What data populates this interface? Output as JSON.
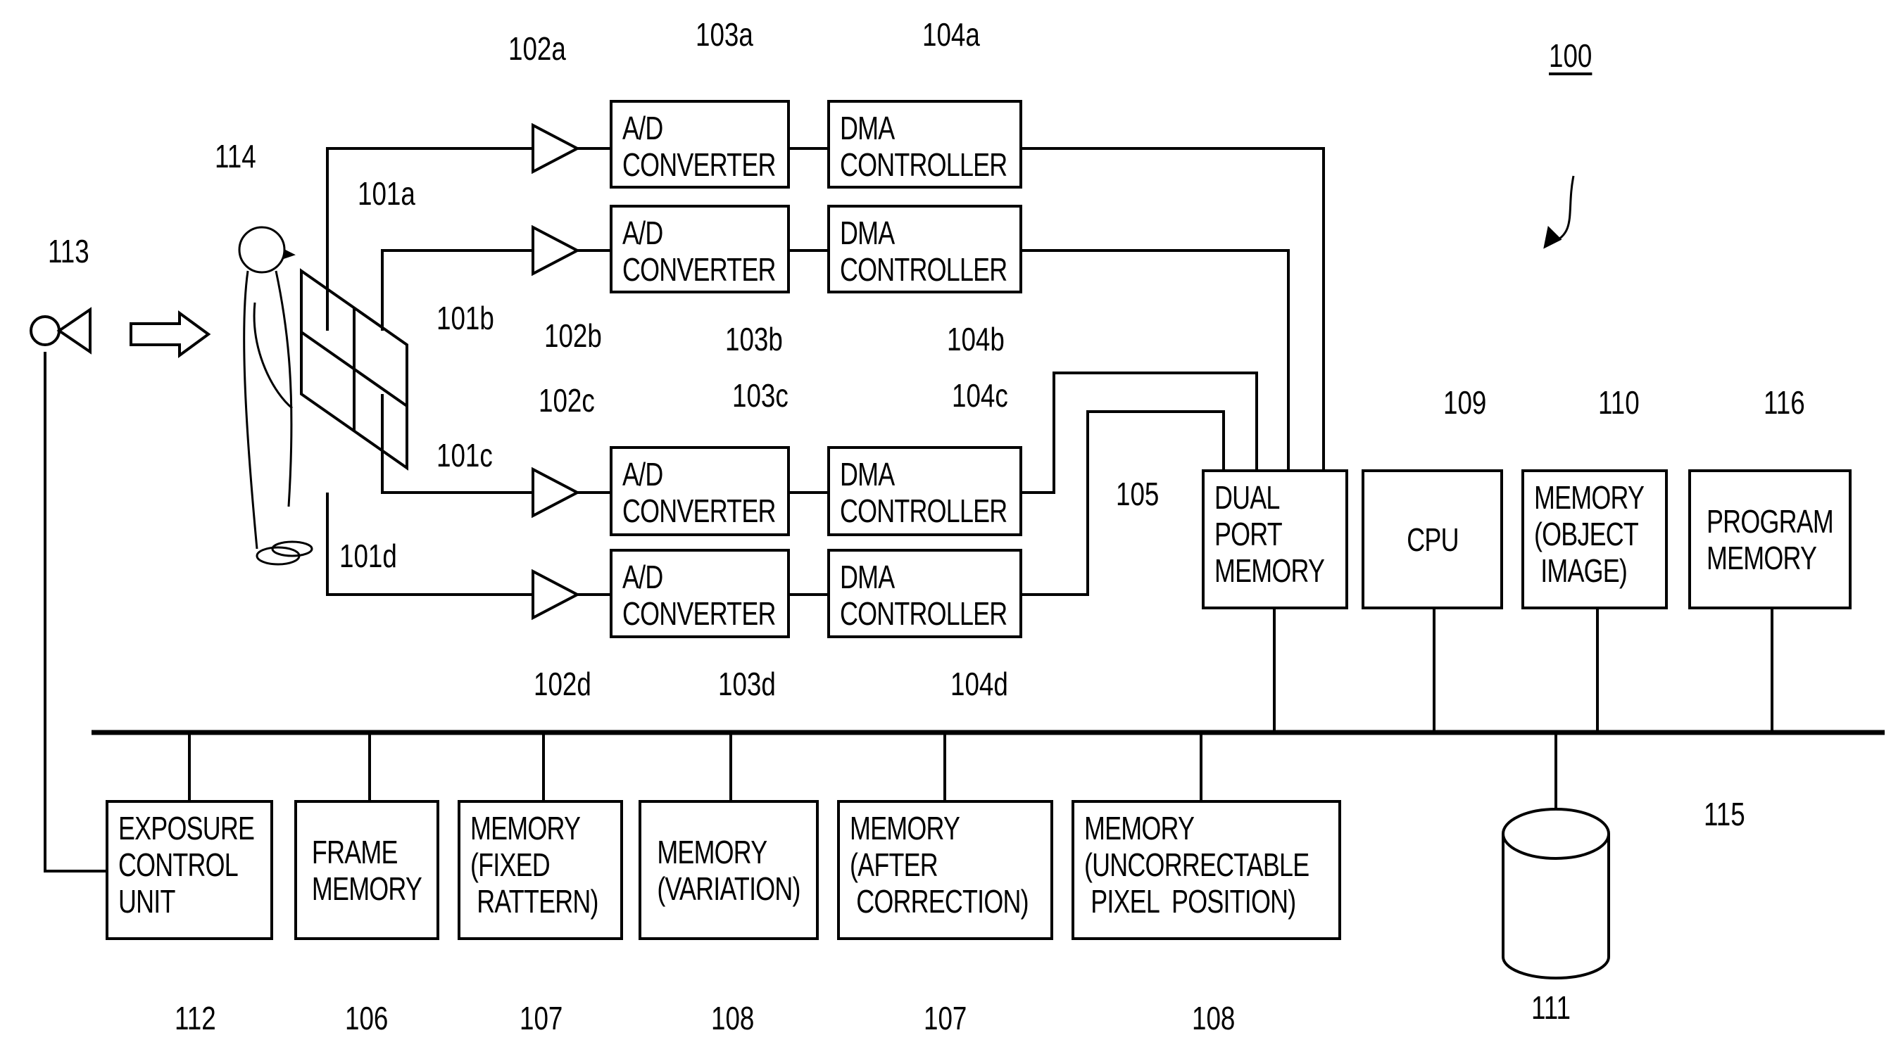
{
  "figure": {
    "system_ref": "100",
    "person_ref": "114",
    "light_source_ref": "113",
    "bus_ref": "115",
    "disk_ref": "111",
    "sensor_refs": [
      "101a",
      "101b",
      "101c",
      "101d"
    ]
  },
  "channels": [
    {
      "amp_ref": "102a",
      "adc_ref": "103a",
      "dma_ref": "104a",
      "adc_label": "A/D\nCONVERTER",
      "dma_label": "DMA\nCONTROLLER"
    },
    {
      "amp_ref": "102b",
      "adc_ref": "103b",
      "dma_ref": "104b",
      "adc_label": "A/D\nCONVERTER",
      "dma_label": "DMA\nCONTROLLER"
    },
    {
      "amp_ref": "102c",
      "adc_ref": "103c",
      "dma_ref": "104c",
      "adc_label": "A/D\nCONVERTER",
      "dma_label": "DMA\nCONTROLLER"
    },
    {
      "amp_ref": "102d",
      "adc_ref": "103d",
      "dma_ref": "104d",
      "adc_label": "A/D\nCONVERTER",
      "dma_label": "DMA\nCONTROLLER"
    }
  ],
  "upper_blocks": [
    {
      "ref": "105",
      "label": "DUAL\nPORT\nMEMORY"
    },
    {
      "ref": "109",
      "label": "CPU"
    },
    {
      "ref": "110",
      "label": "MEMORY\n(OBJECT\n IMAGE)"
    },
    {
      "ref": "116",
      "label": "PROGRAM\nMEMORY"
    }
  ],
  "lower_blocks": [
    {
      "ref": "112",
      "label": "EXPOSURE\nCONTROL\nUNIT"
    },
    {
      "ref": "106",
      "label": "FRAME\nMEMORY"
    },
    {
      "ref": "107",
      "label": "MEMORY\n(FIXED\n RATTERN)"
    },
    {
      "ref": "108",
      "label": "MEMORY\n(VARIATION)"
    },
    {
      "ref": "107",
      "label": "MEMORY\n(AFTER\n CORRECTION)"
    },
    {
      "ref": "108",
      "label": "MEMORY\n(UNCORRECTABLE\n PIXEL  POSITION)"
    }
  ]
}
